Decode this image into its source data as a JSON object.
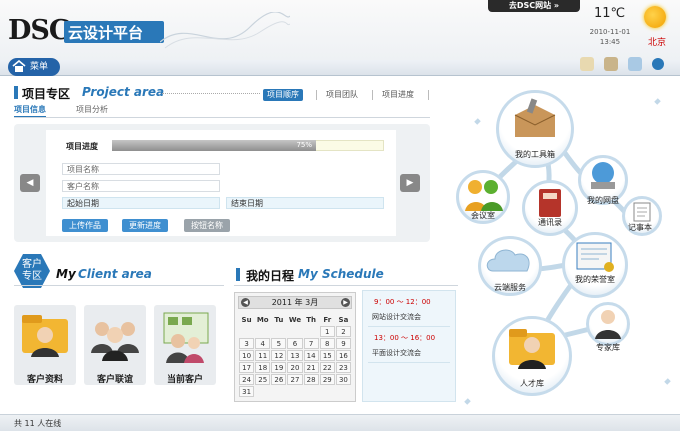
{
  "header": {
    "logo_text": "DSC",
    "platform_name": "云设计平台",
    "go_dsc": "去DSC网站 »",
    "weather": {
      "temp": "11℃",
      "date": "2010-11-01",
      "time": "13:45",
      "city": "北京"
    }
  },
  "menu": {
    "label": "菜单"
  },
  "project": {
    "title": "项目专区",
    "title_en": "Project area",
    "tabs": [
      "项目顺序",
      "项目团队",
      "项目进度"
    ],
    "subtabs": [
      "项目信息",
      "项目分析"
    ],
    "progress_label": "项目进度",
    "progress_text": "75%",
    "progress_value": 0.75,
    "fields": {
      "name": "项目名称",
      "client": "客户名称",
      "start": "起始日期",
      "end": "结束日期"
    },
    "buttons": [
      "上传作品",
      "更新进度",
      "按钮名称"
    ]
  },
  "client": {
    "badge_line1": "客户",
    "badge_line2": "专区",
    "title": "My",
    "title_en": "Client area",
    "items": [
      "客户资料",
      "客户联谊",
      "当前客户"
    ]
  },
  "schedule": {
    "title": "我的日程",
    "title_en": "My Schedule",
    "calendar": {
      "header": "2011 年   3月",
      "weekdays": [
        "Su",
        "Mo",
        "Tu",
        "We",
        "Th",
        "Fr",
        "Sa"
      ],
      "weeks": [
        [
          "",
          "",
          "",
          "",
          "",
          "",
          ""
        ],
        [
          "",
          "",
          "",
          "",
          "",
          "1",
          "2"
        ],
        [
          "3",
          "4",
          "5",
          "6",
          "7",
          "8",
          "9"
        ],
        [
          "10",
          "11",
          "12",
          "13",
          "14",
          "15",
          "16"
        ],
        [
          "17",
          "18",
          "19",
          "20",
          "21",
          "22",
          "23"
        ],
        [
          "24",
          "25",
          "26",
          "27",
          "28",
          "29",
          "30"
        ],
        [
          "31",
          "",
          "",
          "",
          "",
          "",
          ""
        ]
      ]
    },
    "events": [
      {
        "time": "9：00  ～ 12：00",
        "title": "网站设计交流会"
      },
      {
        "time": "13：00  ～  16：00",
        "title": "平面设计交流会"
      }
    ]
  },
  "tools": {
    "toolbox": "我的工具箱",
    "meeting": "会议室",
    "contacts": "通讯录",
    "disk": "我的网盘",
    "notes": "记事本",
    "cloud": "云端服务",
    "honors": "我的荣誉室",
    "experts": "专家库",
    "talent": "人才库"
  },
  "footer": {
    "online": "共 11 人在线"
  }
}
